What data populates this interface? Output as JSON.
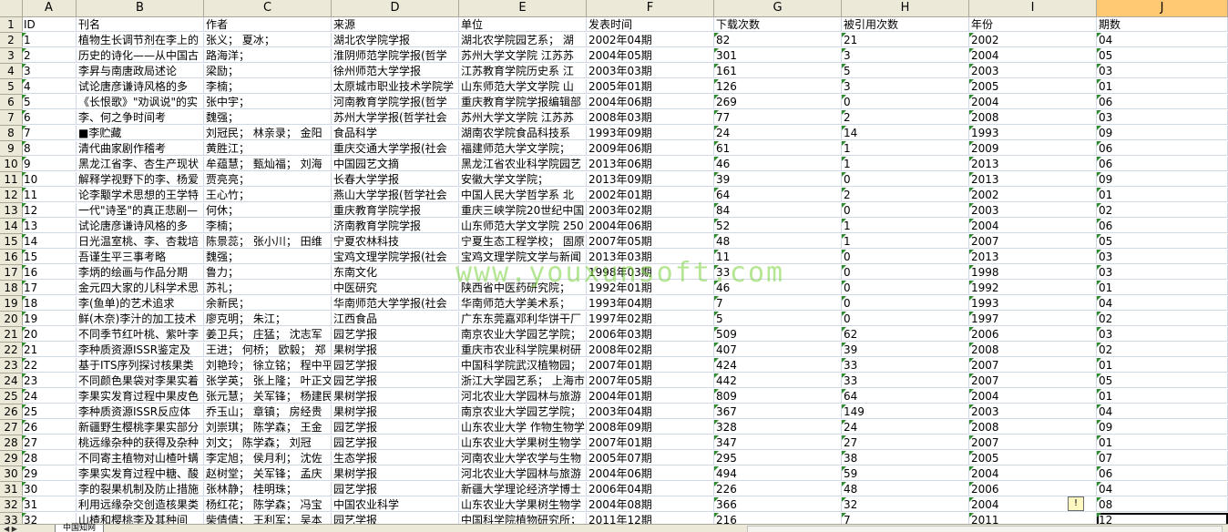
{
  "columns": [
    "A",
    "B",
    "C",
    "D",
    "E",
    "F",
    "G",
    "H",
    "I",
    "J"
  ],
  "selected_column": "J",
  "watermark": "www.youxunsoft.com",
  "sheet_tab": "中国知网",
  "row_numbers": [
    "1",
    "2",
    "3",
    "4",
    "5",
    "6",
    "7",
    "8",
    "9",
    "10",
    "11",
    "12",
    "13",
    "14",
    "15",
    "16",
    "17",
    "18",
    "19",
    "20",
    "21",
    "22",
    "23",
    "24",
    "25",
    "26",
    "27",
    "28",
    "29",
    "30",
    "31",
    "32",
    "33"
  ],
  "rows": [
    [
      "ID",
      "刊名",
      "作者",
      "来源",
      "单位",
      "发表时间",
      "下载次数",
      "被引用次数",
      "年份",
      "期数"
    ],
    [
      "1",
      "植物生长调节剂在李上的",
      "张义； 夏冰；",
      "湖北农学院学报",
      "湖北农学院园艺系； 湖",
      "2002年04期",
      "82",
      "21",
      "2002",
      "04"
    ],
    [
      "2",
      "历史的诗化——从中国古",
      "路海洋；",
      "淮阴师范学院学报(哲学",
      "苏州大学文学院 江苏苏",
      "2004年05期",
      "301",
      "3",
      "2004",
      "05"
    ],
    [
      "3",
      "李昇与南唐政局述论",
      "梁励；",
      "徐州师范大学学报",
      "江苏教育学院历史系 江",
      "2003年03期",
      "161",
      "5",
      "2003",
      "03"
    ],
    [
      "4",
      "试论唐彦谦诗风格的多",
      "李楠；",
      "太原城市职业技术学院学",
      "山东师范大学文学院 山",
      "2005年01期",
      "126",
      "3",
      "2005",
      "01"
    ],
    [
      "5",
      "《长恨歌》\"劝讽说\"的实",
      "张中宇；",
      "河南教育学院学报(哲学",
      "重庆教育学院学报编辑部",
      "2004年06期",
      "269",
      "0",
      "2004",
      "06"
    ],
    [
      "6",
      "李、何之争时间考",
      "魏强；",
      "苏州大学学报(哲学社会",
      "苏州大学文学院 江苏苏",
      "2008年03期",
      "77",
      "2",
      "2008",
      "03"
    ],
    [
      "7",
      "■李贮藏",
      "刘冠民； 林亲录； 金阳",
      "食品科学",
      "湖南农学院食品科技系",
      "1993年09期",
      "24",
      "14",
      "1993",
      "09"
    ],
    [
      "8",
      "清代曲家剧作稽考",
      "黄胜江；",
      "重庆交通大学学报(社会",
      "福建师范大学文学院；",
      "2009年06期",
      "61",
      "1",
      "2009",
      "06"
    ],
    [
      "9",
      "黑龙江省李、杏生产现状",
      "牟蕴慧； 甄灿福； 刘海",
      "中国园艺文摘",
      "黑龙江省农业科学院园艺",
      "2013年06期",
      "46",
      "1",
      "2013",
      "06"
    ],
    [
      "10",
      "解释学视野下的李、杨爱",
      "贾亮亮；",
      "长春大学学报",
      "安徽大学文学院；",
      "2013年09期",
      "39",
      "0",
      "2013",
      "09"
    ],
    [
      "11",
      "论李颙学术思想的王学特",
      "王心竹；",
      "燕山大学学报(哲学社会",
      "中国人民大学哲学系 北",
      "2002年01期",
      "64",
      "2",
      "2002",
      "01"
    ],
    [
      "12",
      "一代\"诗圣\"的真正悲剧—",
      "何休；",
      "重庆教育学院学报",
      "重庆三峡学院20世纪中国",
      "2003年02期",
      "84",
      "0",
      "2003",
      "02"
    ],
    [
      "13",
      "试论唐彦谦诗风格的多",
      "李楠；",
      "济南教育学院学报",
      "山东师范大学文学院 250",
      "2004年06期",
      "52",
      "1",
      "2004",
      "06"
    ],
    [
      "14",
      "日光温室桃、李、杏栽培",
      "陈景蕊； 张小川； 田维",
      "宁夏农林科技",
      "宁夏生态工程学校； 固原",
      "2007年05期",
      "48",
      "1",
      "2007",
      "05"
    ],
    [
      "15",
      "吾谨生平三事考略",
      "魏强；",
      "宝鸡文理学院学报(社会",
      "宝鸡文理学院文学与新闻",
      "2013年03期",
      "11",
      "0",
      "2013",
      "03"
    ],
    [
      "16",
      "李炳的绘画与作品分期",
      "鲁力；",
      "东南文化",
      "",
      "1998年03期",
      "33",
      "0",
      "1998",
      "03"
    ],
    [
      "17",
      "金元四大家的儿科学术思",
      "苏礼；",
      "中医研究",
      "陕西省中医药研究院；",
      "1992年01期",
      "46",
      "0",
      "1992",
      "01"
    ],
    [
      "18",
      "李(鱼单)的艺术追求",
      "余新民；",
      "华南师范大学学报(社会",
      "华南师范大学美术系；",
      "1993年04期",
      "7",
      "0",
      "1993",
      "04"
    ],
    [
      "19",
      "鲜(木奈)李汁的加工技术",
      "廖克明； 朱江；",
      "江西食品",
      "广东东莞嘉邓利华饼干厂",
      "1997年02期",
      "5",
      "0",
      "1997",
      "02"
    ],
    [
      "20",
      "不同季节红叶桃、紫叶李",
      "姜卫兵； 庄猛； 沈志军",
      "园艺学报",
      "南京农业大学园艺学院；",
      "2006年03期",
      "509",
      "62",
      "2006",
      "03"
    ],
    [
      "21",
      "李种质资源ISSR鉴定及",
      "王进； 何桥； 欧毅； 郑",
      "果树学报",
      "重庆市农业科学院果树研",
      "2008年02期",
      "407",
      "39",
      "2008",
      "02"
    ],
    [
      "22",
      "基于ITS序列探讨核果类",
      "刘艳玲； 徐立铭； 程中平",
      "园艺学报",
      "中国科学院武汉植物园；",
      "2007年01期",
      "424",
      "33",
      "2007",
      "01"
    ],
    [
      "23",
      "不同颜色果袋对李果实着",
      "张学英； 张上隆； 叶正文",
      "园艺学报",
      "浙江大学园艺系； 上海市",
      "2007年05期",
      "442",
      "33",
      "2007",
      "05"
    ],
    [
      "24",
      "李果实发育过程中果皮色",
      "张元慧； 关军锋； 杨建民",
      "果树学报",
      "河北农业大学园林与旅游",
      "2004年01期",
      "809",
      "64",
      "2004",
      "01"
    ],
    [
      "25",
      "李种质资源ISSR反应体",
      "乔玉山； 章镇； 房经贵",
      "果树学报",
      "南京农业大学园艺学院；",
      "2003年04期",
      "367",
      "149",
      "2003",
      "04"
    ],
    [
      "26",
      "新疆野生樱桃李果实部分",
      "刘崇琪； 陈学森； 王金",
      "园艺学报",
      "山东农业大学 作物生物学",
      "2008年09期",
      "328",
      "24",
      "2008",
      "09"
    ],
    [
      "27",
      "桃远缘杂种的获得及杂种",
      "刘文； 陈学森； 刘冠",
      "园艺学报",
      "山东农业大学果树生物学",
      "2007年01期",
      "347",
      "27",
      "2007",
      "01"
    ],
    [
      "28",
      "不同寄主植物对山楂叶螨",
      "李定旭； 侯月利； 沈佐",
      "生态学报",
      "河南农业大学农学与生物",
      "2005年07期",
      "295",
      "38",
      "2005",
      "07"
    ],
    [
      "29",
      "李果实发育过程中糖、酸",
      "赵树堂； 关军锋； 孟庆",
      "果树学报",
      "河北农业大学园林与旅游",
      "2004年06期",
      "494",
      "59",
      "2004",
      "06"
    ],
    [
      "30",
      "李的裂果机制及防止措施",
      "张林静； 桂明珠；",
      "园艺学报",
      "新疆大学理论经济学博士",
      "2006年04期",
      "226",
      "48",
      "2006",
      "04"
    ],
    [
      "31",
      "利用远缘杂交创造核果类",
      "杨红花； 陈学森； 冯宝",
      "中国农业科学",
      "山东农业大学果树生物学",
      "2004年08期",
      "366",
      "32",
      "2004",
      "08"
    ],
    [
      "32",
      "山楂和樱桃李及其种间",
      "柴倩倩； 王利军； 吴本",
      "园艺学报",
      "中国科学院植物研究所；",
      "2011年12期",
      "216",
      "7",
      "2011",
      "12"
    ]
  ]
}
